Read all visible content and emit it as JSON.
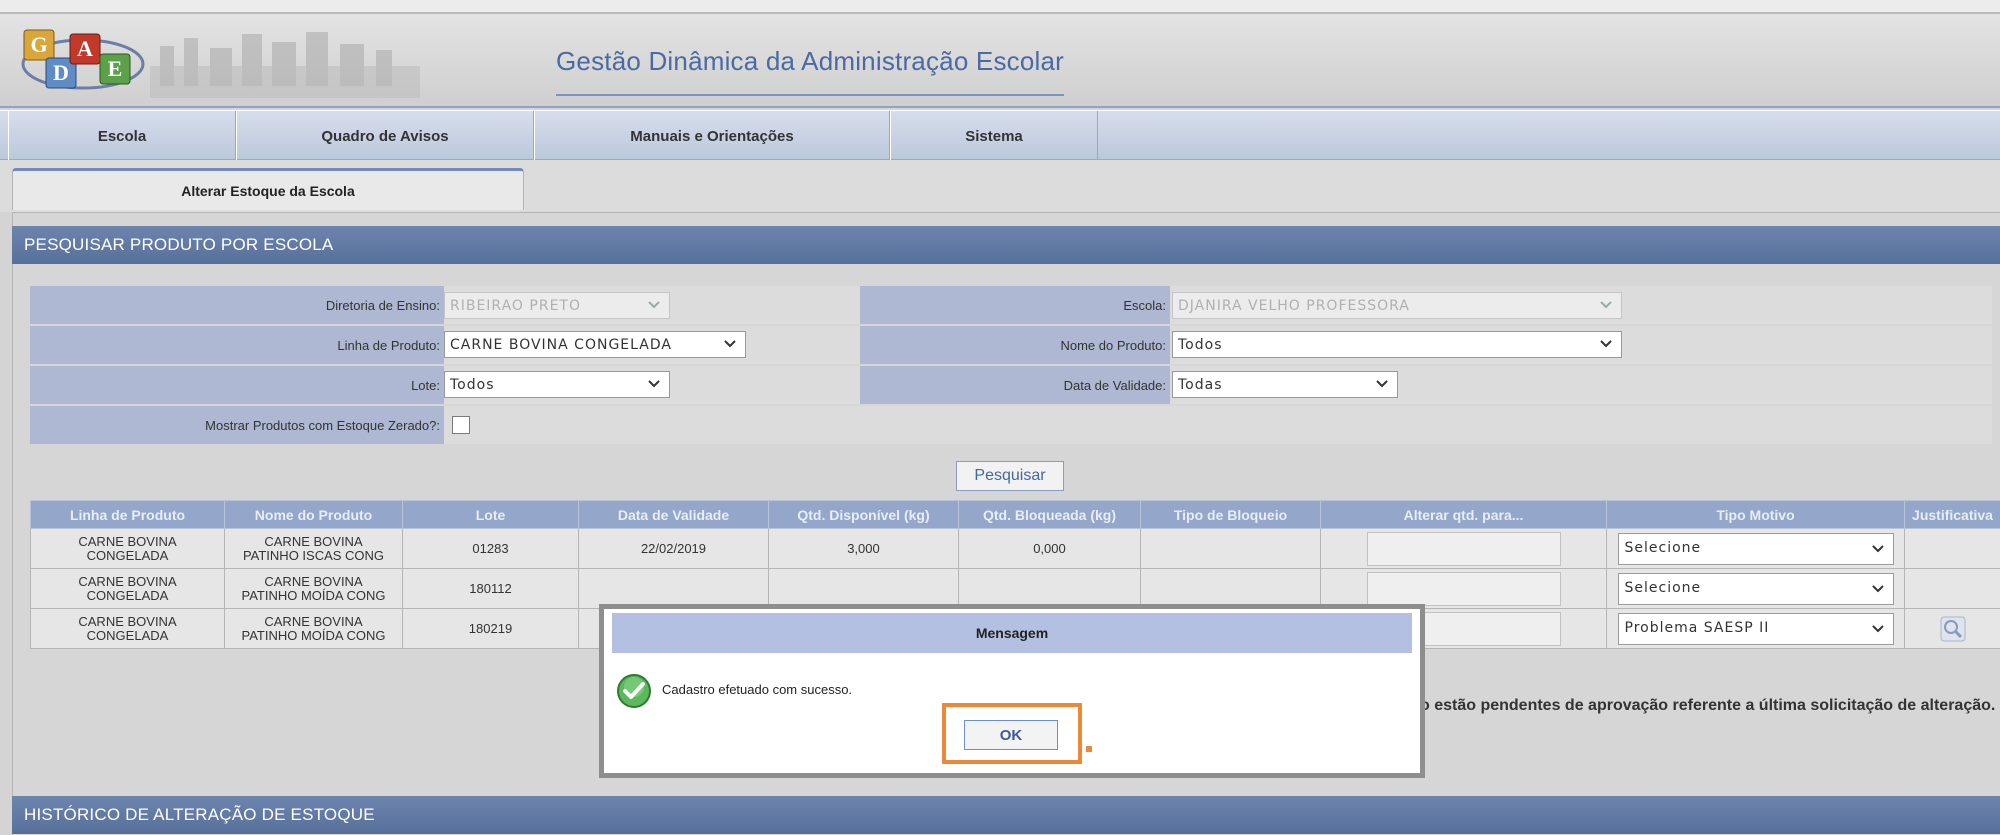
{
  "header": {
    "logo_letters": [
      "G",
      "D",
      "A",
      "E"
    ],
    "app_title": "Gestão Dinâmica da Administração Escolar"
  },
  "menu": {
    "items": [
      {
        "label": "Escola"
      },
      {
        "label": "Quadro de Avisos"
      },
      {
        "label": "Manuais e Orientações"
      },
      {
        "label": "Sistema"
      }
    ]
  },
  "tab": {
    "label": "Alterar Estoque da Escola"
  },
  "search_section": {
    "title": "PESQUISAR PRODUTO POR ESCOLA",
    "fields": {
      "diretoria_label": "Diretoria de Ensino:",
      "diretoria_value": "RIBEIRAO PRETO",
      "escola_label": "Escola:",
      "escola_value": "DJANIRA VELHO PROFESSORA",
      "linha_label": "Linha de Produto:",
      "linha_value": "CARNE BOVINA CONGELADA",
      "nome_label": "Nome do Produto:",
      "nome_value": "Todos",
      "lote_label": "Lote:",
      "lote_value": "Todos",
      "validade_label": "Data de Validade:",
      "validade_value": "Todas",
      "zerado_label": "Mostrar Produtos com Estoque Zerado?:"
    },
    "search_button": "Pesquisar"
  },
  "table": {
    "headers": [
      "Linha de Produto",
      "Nome do Produto",
      "Lote",
      "Data de Validade",
      "Qtd. Disponível (kg)",
      "Qtd. Bloqueada (kg)",
      "Tipo de Bloqueio",
      "Alterar qtd. para...",
      "Tipo Motivo",
      "Justificativa"
    ],
    "rows": [
      {
        "linha_a": "CARNE BOVINA",
        "linha_b": "CONGELADA",
        "nome_a": "CARNE BOVINA",
        "nome_b": "PATINHO ISCAS CONG",
        "lote": "01283",
        "validade": "22/02/2019",
        "disp": "3,000",
        "bloq": "0,000",
        "motivo": "Selecione"
      },
      {
        "linha_a": "CARNE BOVINA",
        "linha_b": "CONGELADA",
        "nome_a": "CARNE BOVINA",
        "nome_b": "PATINHO MOÍDA CONG",
        "lote": "180112",
        "validade": "",
        "disp": "",
        "bloq": "",
        "motivo": "Selecione"
      },
      {
        "linha_a": "CARNE BOVINA",
        "linha_b": "CONGELADA",
        "nome_a": "CARNE BOVINA",
        "nome_b": "PATINHO MOÍDA CONG",
        "lote": "180219",
        "validade": "",
        "disp": "",
        "bloq": "",
        "motivo": "Problema SAESP II"
      }
    ]
  },
  "pending_text": "o estão pendentes de aprovação referente a última solicitação de alteração.",
  "history_section": {
    "title": "HISTÓRICO DE ALTERAÇÃO DE ESTOQUE"
  },
  "modal": {
    "title": "Mensagem",
    "message": "Cadastro efetuado com sucesso.",
    "ok_label": "OK"
  },
  "colors": {
    "accent_blue": "#57709b",
    "highlight_orange": "#ea8a37",
    "title_blue": "#4a6aa5"
  }
}
